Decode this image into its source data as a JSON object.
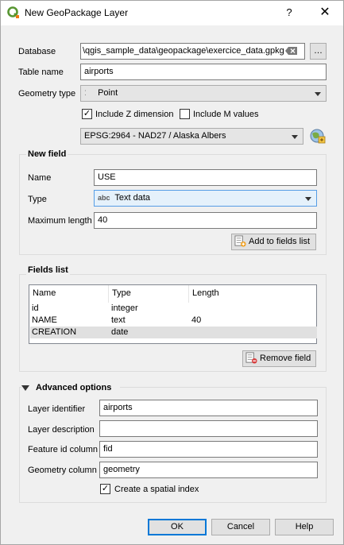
{
  "window": {
    "title": "New GeoPackage Layer",
    "help_glyph": "?",
    "close_glyph": "✕",
    "app_icon": "qgis-logo-icon"
  },
  "form": {
    "database_label": "Database",
    "database_value": "\\qgis_sample_data\\geopackage\\exercice_data.gpkg",
    "browse_label": "…",
    "table_name_label": "Table name",
    "table_name_value": "airports",
    "geometry_type_label": "Geometry type",
    "geometry_type_value": "Point",
    "include_z_label": "Include Z dimension",
    "include_z_checked": true,
    "include_m_label": "Include M values",
    "include_m_checked": false,
    "crs_value": "EPSG:2964 - NAD27 / Alaska Albers"
  },
  "new_field": {
    "title": "New field",
    "name_label": "Name",
    "name_value": "USE",
    "type_label": "Type",
    "type_badge": "abc",
    "type_value": "Text data",
    "maxlen_label": "Maximum length",
    "maxlen_value": "40",
    "add_button": "Add to fields list"
  },
  "fields_list": {
    "title": "Fields list",
    "headers": [
      "Name",
      "Type",
      "Length"
    ],
    "rows": [
      {
        "name": "id",
        "type": "integer",
        "length": ""
      },
      {
        "name": "NAME",
        "type": "text",
        "length": "40"
      },
      {
        "name": "CREATION",
        "type": "date",
        "length": ""
      }
    ],
    "remove_button": "Remove field"
  },
  "advanced": {
    "title": "Advanced options",
    "layer_identifier_label": "Layer identifier",
    "layer_identifier_value": "airports",
    "layer_description_label": "Layer description",
    "layer_description_value": "",
    "feature_id_label": "Feature id column",
    "feature_id_value": "fid",
    "geometry_column_label": "Geometry column",
    "geometry_column_value": "geometry",
    "spatial_index_label": "Create a spatial index",
    "spatial_index_checked": true
  },
  "buttons": {
    "ok": "OK",
    "cancel": "Cancel",
    "help": "Help"
  },
  "colors": {
    "accent": "#0078d7",
    "qgis_green": "#589632",
    "qgis_yellow": "#ee7913"
  }
}
